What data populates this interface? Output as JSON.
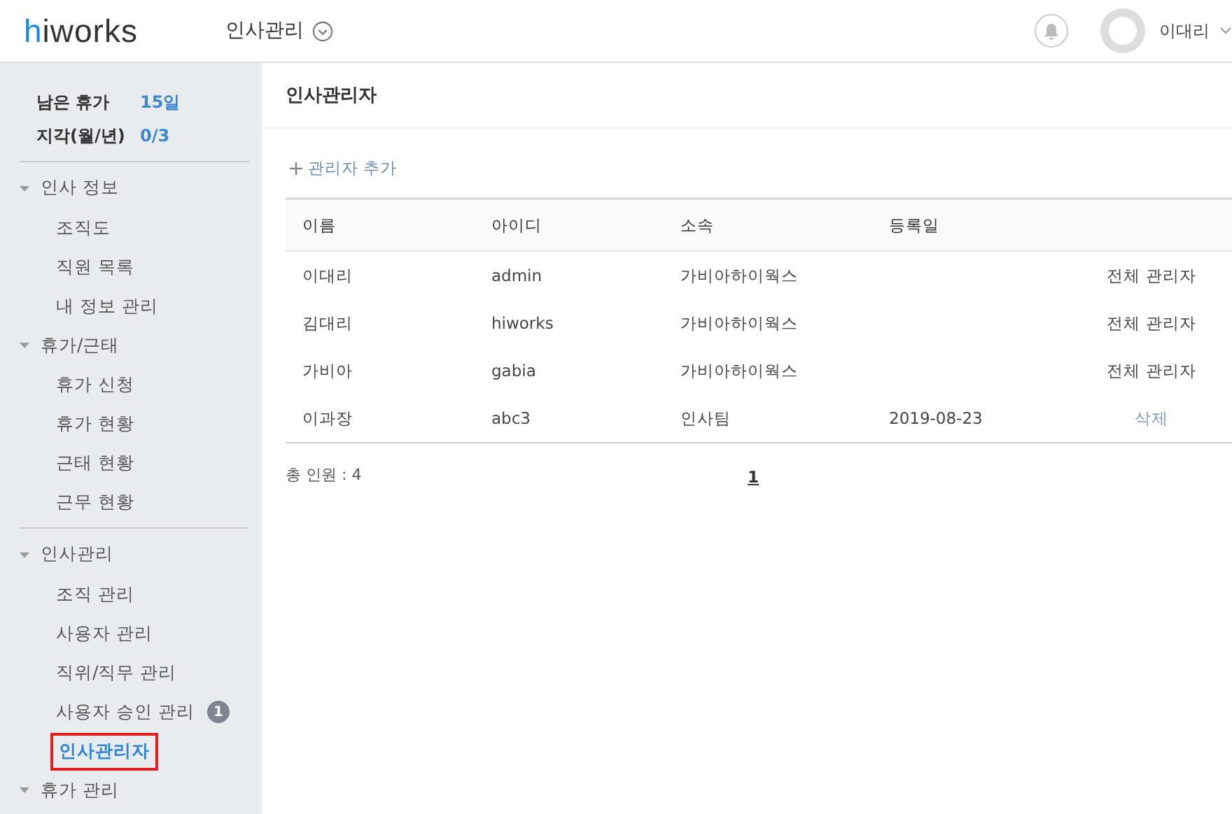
{
  "header": {
    "logo": "hiworks",
    "menu": "인사관리",
    "user": "이대리"
  },
  "summary": [
    {
      "label": "남은 휴가",
      "value": "15일"
    },
    {
      "label": "지각(월/년)",
      "value": "0/3"
    }
  ],
  "nav": [
    {
      "label": "인사 정보",
      "expanded": true,
      "divider": true,
      "children": [
        {
          "label": "조직도",
          "selected": false
        },
        {
          "label": "직원 목록",
          "selected": false
        },
        {
          "label": "내 정보 관리",
          "selected": false
        }
      ]
    },
    {
      "label": "휴가/근태",
      "expanded": true,
      "divider": false,
      "children": [
        {
          "label": "휴가 신청",
          "selected": false
        },
        {
          "label": "휴가 현황",
          "selected": false
        },
        {
          "label": "근태 현황",
          "selected": false
        },
        {
          "label": "근무 현황",
          "selected": false
        }
      ]
    },
    {
      "label": "인사관리",
      "expanded": true,
      "divider": true,
      "children": [
        {
          "label": "조직 관리",
          "selected": false
        },
        {
          "label": "사용자 관리",
          "selected": false
        },
        {
          "label": "직위/직무 관리",
          "selected": false
        },
        {
          "label": "사용자 승인 관리",
          "selected": false,
          "badge": "1"
        },
        {
          "label": "인사관리자",
          "selected": true
        }
      ]
    },
    {
      "label": "휴가 관리",
      "expanded": true,
      "divider": false
    }
  ],
  "page_title": "인사관리자",
  "add_button": "관리자 추가",
  "table": {
    "columns": [
      "이름",
      "아이디",
      "소속",
      "등록일"
    ],
    "rows": [
      {
        "cells": [
          "이대리",
          "admin",
          "가비아하이웍스"
        ],
        "last": {
          "kind": "role",
          "text": "전체 관리자"
        }
      },
      {
        "cells": [
          "김대리",
          "hiworks",
          "가비아하이웍스"
        ],
        "last": {
          "kind": "role",
          "text": "전체 관리자"
        }
      },
      {
        "cells": [
          "가비아",
          "gabia",
          "가비아하이웍스"
        ],
        "last": {
          "kind": "role",
          "text": "전체 관리자"
        }
      },
      {
        "cells": [
          "이과장",
          "abc3",
          "인사팀"
        ],
        "date": "2019-08-23",
        "last": {
          "kind": "action",
          "text": "삭제"
        }
      }
    ]
  },
  "total": "총 인원 : 4",
  "pages": [
    {
      "label": "1",
      "selected": true
    }
  ]
}
